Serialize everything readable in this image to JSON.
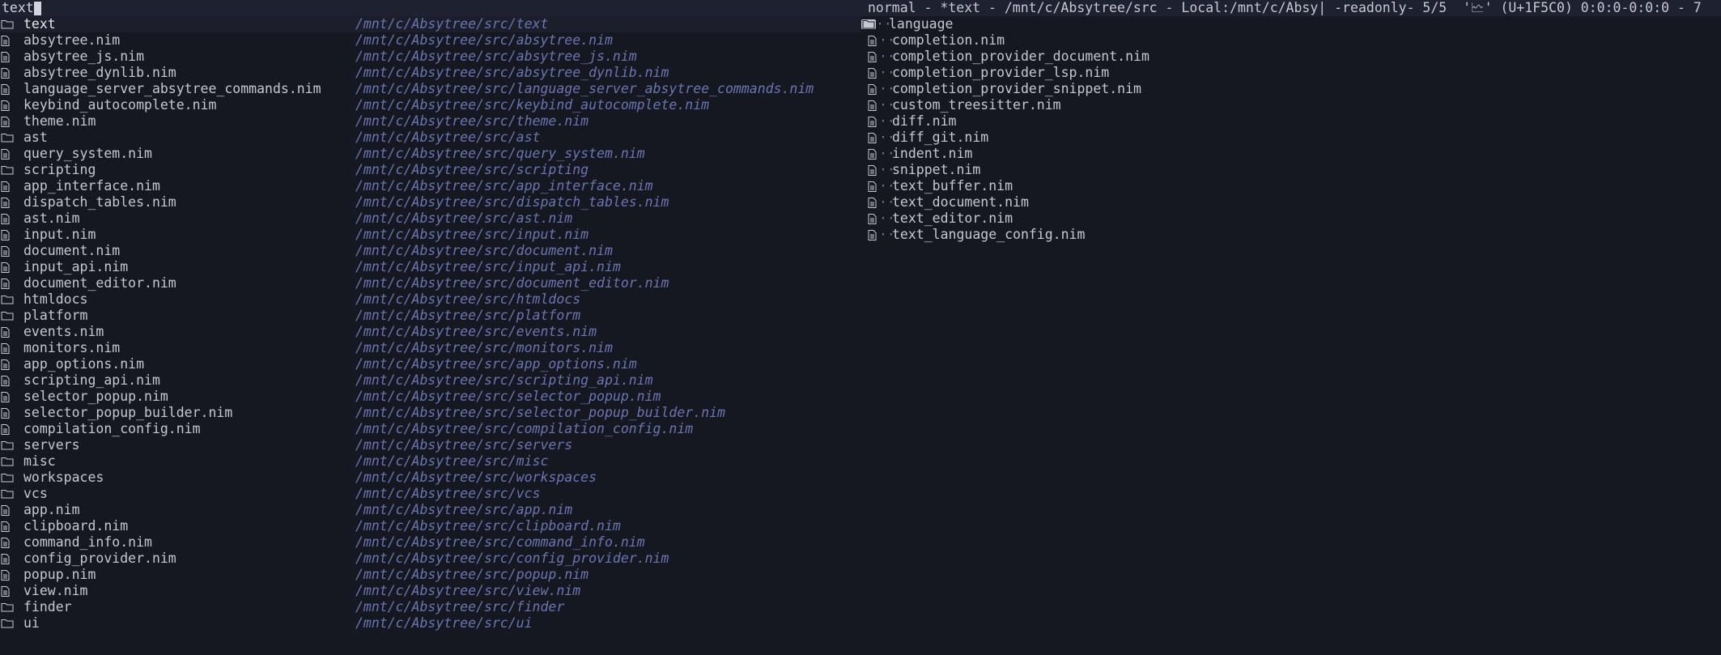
{
  "search": {
    "query": "text"
  },
  "results": [
    {
      "icon": "folder-icon",
      "name": "text",
      "path": "/mnt/c/Absytree/src/text"
    },
    {
      "icon": "file-icon",
      "name": "absytree.nim",
      "path": "/mnt/c/Absytree/src/absytree.nim"
    },
    {
      "icon": "file-icon",
      "name": "absytree_js.nim",
      "path": "/mnt/c/Absytree/src/absytree_js.nim"
    },
    {
      "icon": "file-icon",
      "name": "absytree_dynlib.nim",
      "path": "/mnt/c/Absytree/src/absytree_dynlib.nim"
    },
    {
      "icon": "file-icon",
      "name": "language_server_absytree_commands.nim",
      "path": "/mnt/c/Absytree/src/language_server_absytree_commands.nim"
    },
    {
      "icon": "file-icon",
      "name": "keybind_autocomplete.nim",
      "path": "/mnt/c/Absytree/src/keybind_autocomplete.nim"
    },
    {
      "icon": "file-icon",
      "name": "theme.nim",
      "path": "/mnt/c/Absytree/src/theme.nim"
    },
    {
      "icon": "folder-icon",
      "name": "ast",
      "path": "/mnt/c/Absytree/src/ast"
    },
    {
      "icon": "file-icon",
      "name": "query_system.nim",
      "path": "/mnt/c/Absytree/src/query_system.nim"
    },
    {
      "icon": "folder-icon",
      "name": "scripting",
      "path": "/mnt/c/Absytree/src/scripting"
    },
    {
      "icon": "file-icon",
      "name": "app_interface.nim",
      "path": "/mnt/c/Absytree/src/app_interface.nim"
    },
    {
      "icon": "file-icon",
      "name": "dispatch_tables.nim",
      "path": "/mnt/c/Absytree/src/dispatch_tables.nim"
    },
    {
      "icon": "file-icon",
      "name": "ast.nim",
      "path": "/mnt/c/Absytree/src/ast.nim"
    },
    {
      "icon": "file-icon",
      "name": "input.nim",
      "path": "/mnt/c/Absytree/src/input.nim"
    },
    {
      "icon": "file-icon",
      "name": "document.nim",
      "path": "/mnt/c/Absytree/src/document.nim"
    },
    {
      "icon": "file-icon",
      "name": "input_api.nim",
      "path": "/mnt/c/Absytree/src/input_api.nim"
    },
    {
      "icon": "file-icon",
      "name": "document_editor.nim",
      "path": "/mnt/c/Absytree/src/document_editor.nim"
    },
    {
      "icon": "folder-icon",
      "name": "htmldocs",
      "path": "/mnt/c/Absytree/src/htmldocs"
    },
    {
      "icon": "folder-icon",
      "name": "platform",
      "path": "/mnt/c/Absytree/src/platform"
    },
    {
      "icon": "file-icon",
      "name": "events.nim",
      "path": "/mnt/c/Absytree/src/events.nim"
    },
    {
      "icon": "file-icon",
      "name": "monitors.nim",
      "path": "/mnt/c/Absytree/src/monitors.nim"
    },
    {
      "icon": "file-icon",
      "name": "app_options.nim",
      "path": "/mnt/c/Absytree/src/app_options.nim"
    },
    {
      "icon": "file-icon",
      "name": "scripting_api.nim",
      "path": "/mnt/c/Absytree/src/scripting_api.nim"
    },
    {
      "icon": "file-icon",
      "name": "selector_popup.nim",
      "path": "/mnt/c/Absytree/src/selector_popup.nim"
    },
    {
      "icon": "file-icon",
      "name": "selector_popup_builder.nim",
      "path": "/mnt/c/Absytree/src/selector_popup_builder.nim"
    },
    {
      "icon": "file-icon",
      "name": "compilation_config.nim",
      "path": "/mnt/c/Absytree/src/compilation_config.nim"
    },
    {
      "icon": "folder-icon",
      "name": "servers",
      "path": "/mnt/c/Absytree/src/servers"
    },
    {
      "icon": "folder-icon",
      "name": "misc",
      "path": "/mnt/c/Absytree/src/misc"
    },
    {
      "icon": "folder-icon",
      "name": "workspaces",
      "path": "/mnt/c/Absytree/src/workspaces"
    },
    {
      "icon": "folder-icon",
      "name": "vcs",
      "path": "/mnt/c/Absytree/src/vcs"
    },
    {
      "icon": "file-icon",
      "name": "app.nim",
      "path": "/mnt/c/Absytree/src/app.nim"
    },
    {
      "icon": "file-icon",
      "name": "clipboard.nim",
      "path": "/mnt/c/Absytree/src/clipboard.nim"
    },
    {
      "icon": "file-icon",
      "name": "command_info.nim",
      "path": "/mnt/c/Absytree/src/command_info.nim"
    },
    {
      "icon": "file-icon",
      "name": "config_provider.nim",
      "path": "/mnt/c/Absytree/src/config_provider.nim"
    },
    {
      "icon": "file-icon",
      "name": "popup.nim",
      "path": "/mnt/c/Absytree/src/popup.nim"
    },
    {
      "icon": "file-icon",
      "name": "view.nim",
      "path": "/mnt/c/Absytree/src/view.nim"
    },
    {
      "icon": "folder-icon",
      "name": "finder",
      "path": "/mnt/c/Absytree/src/finder"
    },
    {
      "icon": "folder-icon",
      "name": "ui",
      "path": "/mnt/c/Absytree/src/ui"
    }
  ],
  "status_bar": {
    "text": "normal - *text - /mnt/c/Absytree/src - Local:/mnt/c/Absy| -readonly- 5/5  '🗠' (U+1F5C0) 0:0:0-0:0:0 - 7"
  },
  "preview": {
    "items": [
      {
        "icon": "folder-icon",
        "name": "language"
      },
      {
        "icon": "file-icon",
        "name": "completion.nim"
      },
      {
        "icon": "file-icon",
        "name": "completion_provider_document.nim"
      },
      {
        "icon": "file-icon",
        "name": "completion_provider_lsp.nim"
      },
      {
        "icon": "file-icon",
        "name": "completion_provider_snippet.nim"
      },
      {
        "icon": "file-icon",
        "name": "custom_treesitter.nim"
      },
      {
        "icon": "file-icon",
        "name": "diff.nim"
      },
      {
        "icon": "file-icon",
        "name": "diff_git.nim"
      },
      {
        "icon": "file-icon",
        "name": "indent.nim"
      },
      {
        "icon": "file-icon",
        "name": "snippet.nim"
      },
      {
        "icon": "file-icon",
        "name": "text_buffer.nim"
      },
      {
        "icon": "file-icon",
        "name": "text_document.nim"
      },
      {
        "icon": "file-icon",
        "name": "text_editor.nim"
      },
      {
        "icon": "file-icon",
        "name": "text_language_config.nim"
      }
    ],
    "tree_marker": "··"
  }
}
